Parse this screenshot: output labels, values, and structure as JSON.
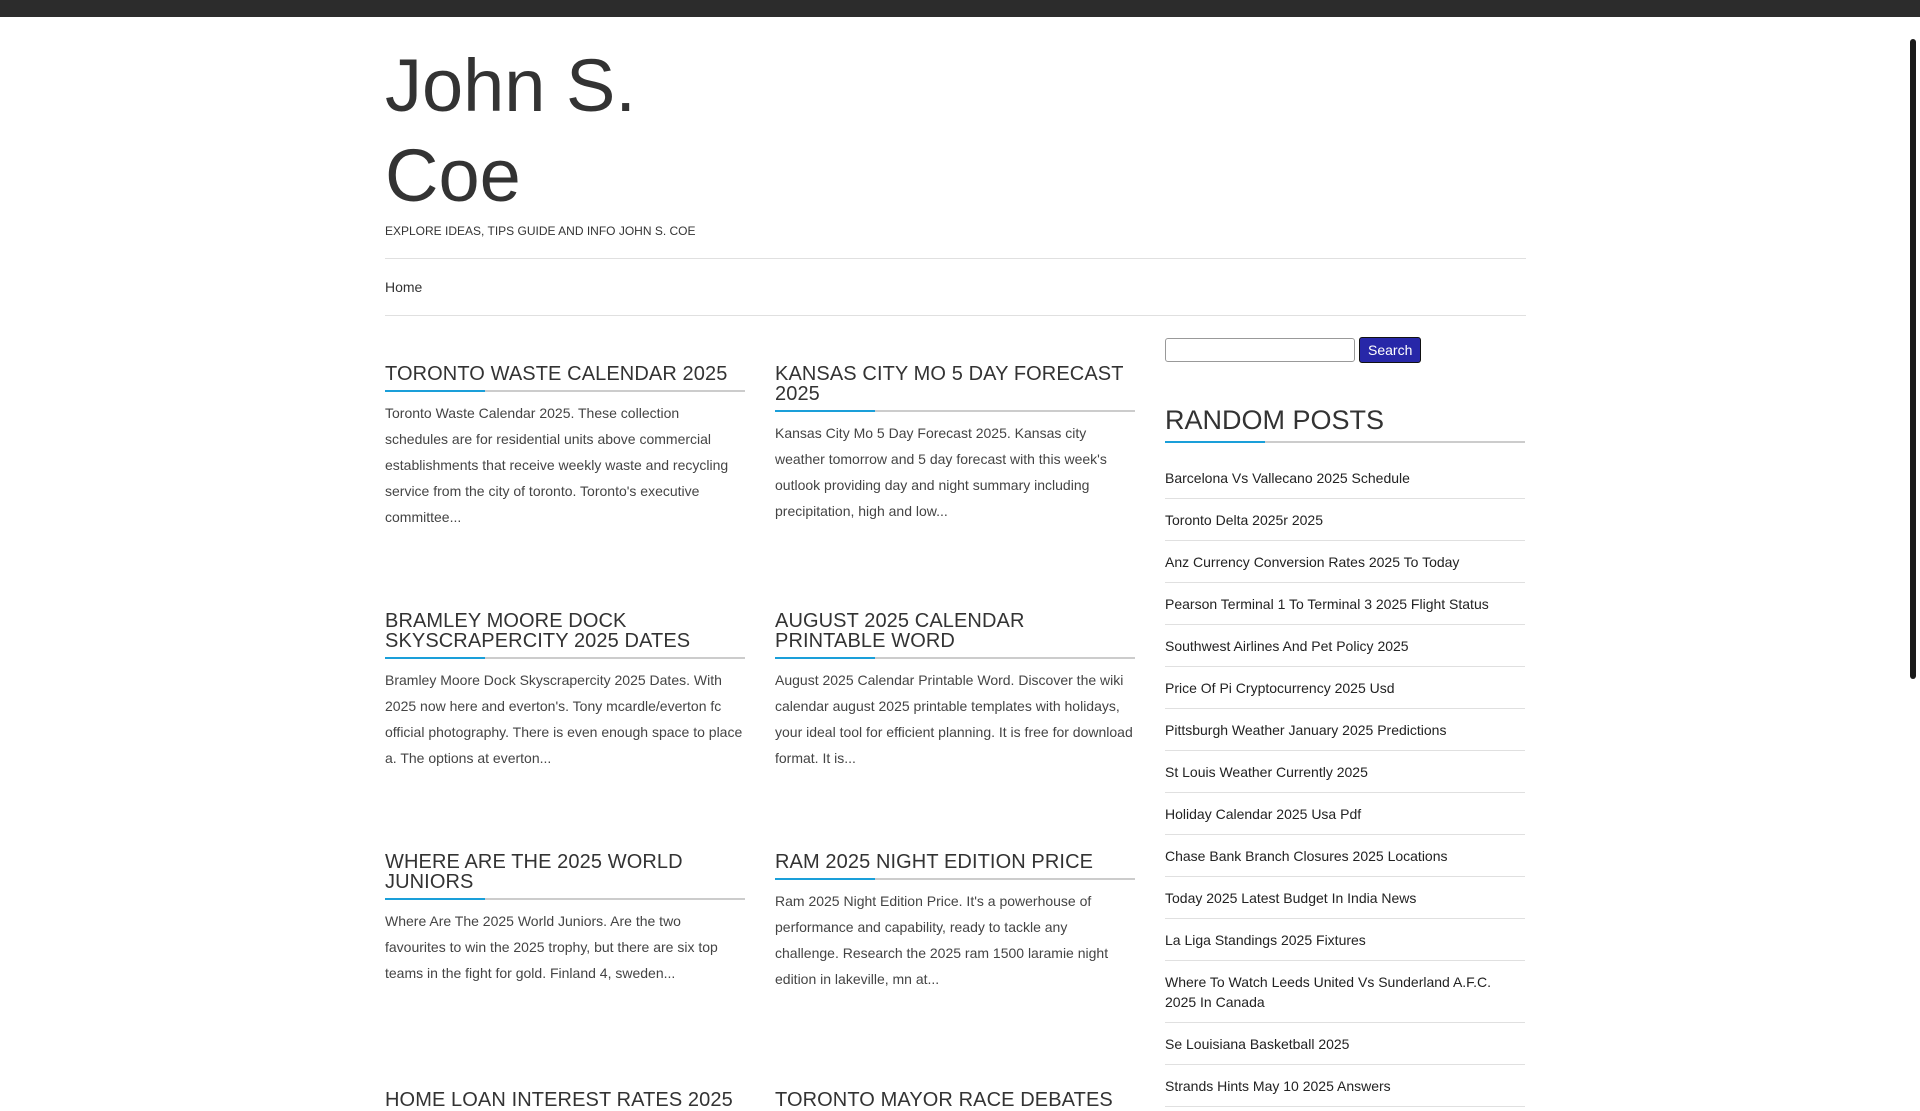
{
  "site": {
    "title": "John S. Coe",
    "tagline": "EXPLORE IDEAS, TIPS GUIDE AND INFO JOHN S. COE"
  },
  "nav": {
    "items": [
      {
        "label": "Home"
      }
    ]
  },
  "posts": [
    {
      "title": "TORONTO WASTE CALENDAR 2025",
      "excerpt": "Toronto Waste Calendar 2025. These collection schedules are for residential units above commercial establishments that receive weekly waste and recycling service from the city of toronto. Toronto's executive committee..."
    },
    {
      "title": "KANSAS CITY MO 5 DAY FORECAST 2025",
      "excerpt": "Kansas City Mo 5 Day Forecast 2025. Kansas city weather tomorrow and 5 day forecast with this week's outlook providing day and night summary including precipitation, high and low..."
    },
    {
      "title": "BRAMLEY MOORE DOCK SKYSCRAPERCITY 2025 DATES",
      "excerpt": "Bramley Moore Dock Skyscrapercity 2025 Dates. With 2025 now here and everton's. Tony mcardle/everton fc official photography. There is even enough space to place a. The options at everton..."
    },
    {
      "title": "AUGUST 2025 CALENDAR PRINTABLE WORD",
      "excerpt": "August 2025 Calendar Printable Word. Discover the wiki calendar august 2025 printable templates with holidays, your ideal tool for efficient planning. It is free for download format. It is..."
    },
    {
      "title": "WHERE ARE THE 2025 WORLD JUNIORS",
      "excerpt": "Where Are The 2025 World Juniors. Are the two favourites to win the 2025 trophy, but there are six top teams in the fight for gold. Finland 4, sweden..."
    },
    {
      "title": "RAM 2025 NIGHT EDITION PRICE",
      "excerpt": "Ram 2025 Night Edition Price. It's a powerhouse of performance and capability, ready to tackle any challenge. Research the 2025 ram 1500 laramie night edition in lakeville, mn at..."
    },
    {
      "title": "HOME LOAN INTEREST RATES 2025",
      "excerpt": ""
    },
    {
      "title": "TORONTO MAYOR RACE DEBATES",
      "excerpt": ""
    }
  ],
  "sidebar": {
    "search_button": "Search",
    "search_value": "",
    "random_title": "RANDOM POSTS",
    "random_posts": [
      "Barcelona Vs Vallecano 2025 Schedule",
      "Toronto Delta 2025r 2025",
      "Anz Currency Conversion Rates 2025 To Today",
      "Pearson Terminal 1 To Terminal 3 2025 Flight Status",
      "Southwest Airlines And Pet Policy 2025",
      "Price Of Pi Cryptocurrency 2025 Usd",
      "Pittsburgh Weather January 2025 Predictions",
      "St Louis Weather Currently 2025",
      "Holiday Calendar 2025 Usa Pdf",
      "Chase Bank Branch Closures 2025 Locations",
      "Today 2025 Latest Budget In India News",
      "La Liga Standings 2025 Fixtures",
      "Where To Watch Leeds United Vs Sunderland A.F.C. 2025 In Canada",
      "Se Louisiana Basketball 2025",
      "Strands Hints May 10 2025 Answers"
    ]
  },
  "colors": {
    "accent": "#1a9fd9",
    "button": "#2727a8",
    "topbar": "#2c2c2c"
  }
}
